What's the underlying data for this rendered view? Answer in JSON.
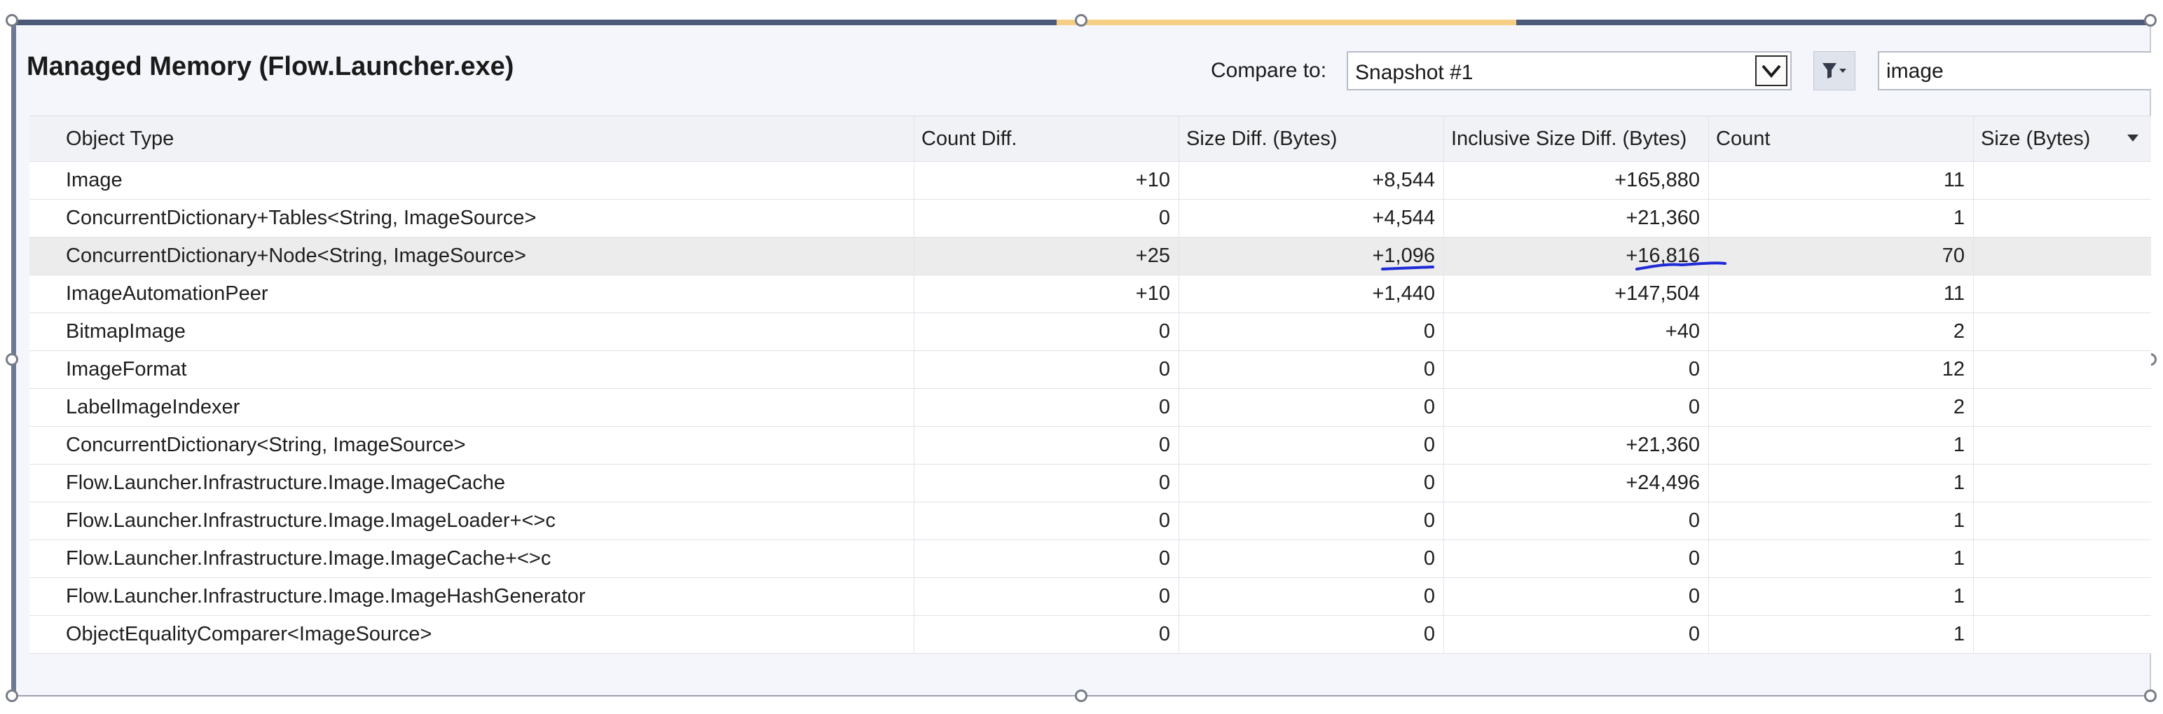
{
  "title": "Managed Memory (Flow.Launcher.exe)",
  "compare": {
    "label": "Compare to:",
    "selected": "Snapshot #1"
  },
  "search": {
    "value": "image"
  },
  "icons": {
    "dropdown": "chevron-down-icon",
    "filter": "filter-icon",
    "sort": "sort-descending-icon"
  },
  "colors": {
    "accent_tab": "#f5cf86",
    "panel_border": "#6d7796",
    "annotation": "#1f2bd6"
  },
  "table": {
    "columns": [
      "Object Type",
      "Count Diff.",
      "Size Diff. (Bytes)",
      "Inclusive Size Diff. (Bytes)",
      "Count",
      "Size (Bytes)"
    ],
    "sort_column": "Size (Bytes)",
    "selected_row": 2,
    "rows": [
      {
        "type": "Image",
        "count_diff": "+10",
        "size_diff": "+8,544",
        "incl_size_diff": "+165,880",
        "count": "11",
        "size": ""
      },
      {
        "type": "ConcurrentDictionary+Tables<String, ImageSource>",
        "count_diff": "0",
        "size_diff": "+4,544",
        "incl_size_diff": "+21,360",
        "count": "1",
        "size": ""
      },
      {
        "type": "ConcurrentDictionary+Node<String, ImageSource>",
        "count_diff": "+25",
        "size_diff": "+1,096",
        "incl_size_diff": "+16,816",
        "count": "70",
        "size": ""
      },
      {
        "type": "ImageAutomationPeer",
        "count_diff": "+10",
        "size_diff": "+1,440",
        "incl_size_diff": "+147,504",
        "count": "11",
        "size": ""
      },
      {
        "type": "BitmapImage",
        "count_diff": "0",
        "size_diff": "0",
        "incl_size_diff": "+40",
        "count": "2",
        "size": ""
      },
      {
        "type": "ImageFormat",
        "count_diff": "0",
        "size_diff": "0",
        "incl_size_diff": "0",
        "count": "12",
        "size": ""
      },
      {
        "type": "LabelImageIndexer",
        "count_diff": "0",
        "size_diff": "0",
        "incl_size_diff": "0",
        "count": "2",
        "size": ""
      },
      {
        "type": "ConcurrentDictionary<String, ImageSource>",
        "count_diff": "0",
        "size_diff": "0",
        "incl_size_diff": "+21,360",
        "count": "1",
        "size": ""
      },
      {
        "type": "Flow.Launcher.Infrastructure.Image.ImageCache",
        "count_diff": "0",
        "size_diff": "0",
        "incl_size_diff": "+24,496",
        "count": "1",
        "size": ""
      },
      {
        "type": "Flow.Launcher.Infrastructure.Image.ImageLoader+<>c",
        "count_diff": "0",
        "size_diff": "0",
        "incl_size_diff": "0",
        "count": "1",
        "size": ""
      },
      {
        "type": "Flow.Launcher.Infrastructure.Image.ImageCache+<>c",
        "count_diff": "0",
        "size_diff": "0",
        "incl_size_diff": "0",
        "count": "1",
        "size": ""
      },
      {
        "type": "Flow.Launcher.Infrastructure.Image.ImageHashGenerator",
        "count_diff": "0",
        "size_diff": "0",
        "incl_size_diff": "0",
        "count": "1",
        "size": ""
      },
      {
        "type": "ObjectEqualityComparer<ImageSource>",
        "count_diff": "0",
        "size_diff": "0",
        "incl_size_diff": "0",
        "count": "1",
        "size": ""
      }
    ]
  }
}
